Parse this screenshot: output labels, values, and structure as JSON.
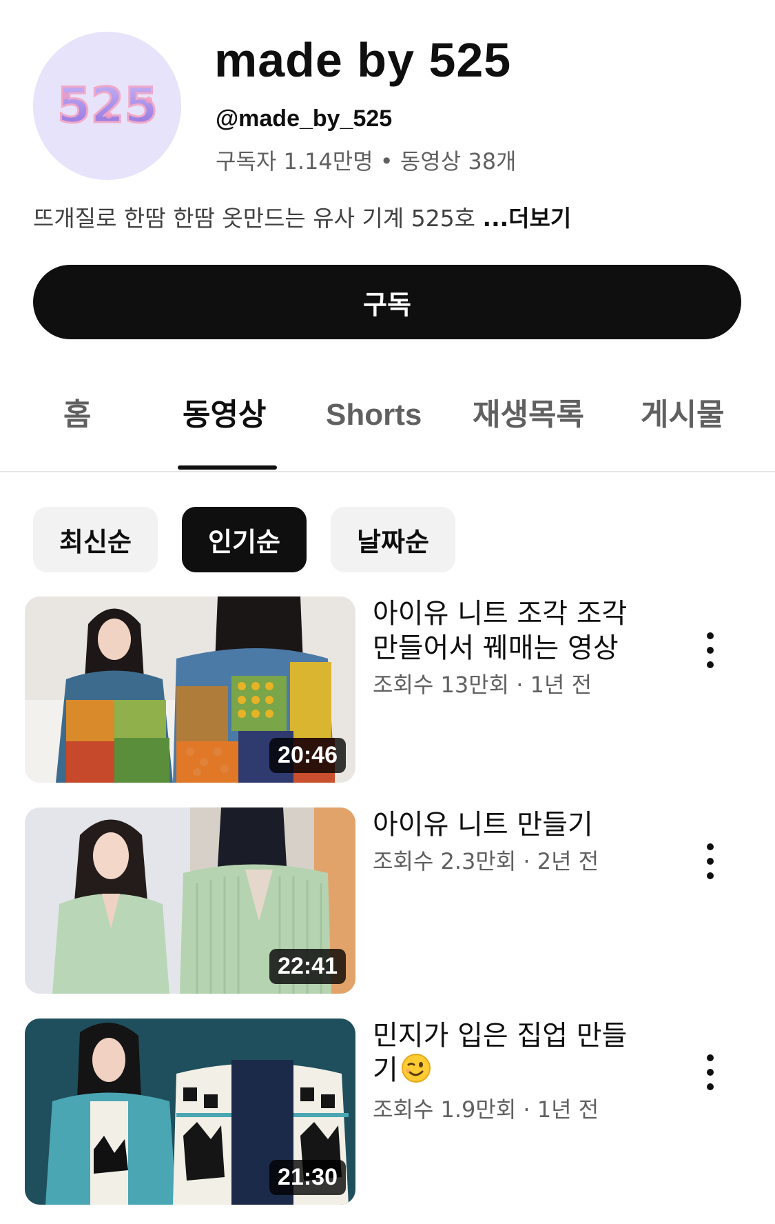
{
  "channel": {
    "avatar_text": "525",
    "name": "made by 525",
    "handle": "@made_by_525",
    "stats": "구독자 1.14만명 • 동영상 38개",
    "description": "뜨개질로 한땀 한땀 옷만드는 유사 기계 525호 ",
    "description_more": "...더보기",
    "subscribe_label": "구독"
  },
  "tabs": [
    {
      "label": "홈",
      "active": false
    },
    {
      "label": "동영상",
      "active": true
    },
    {
      "label": "Shorts",
      "active": false
    },
    {
      "label": "재생목록",
      "active": false
    },
    {
      "label": "게시물",
      "active": false
    }
  ],
  "chips": [
    {
      "label": "최신순",
      "active": false
    },
    {
      "label": "인기순",
      "active": true
    },
    {
      "label": "날짜순",
      "active": false
    }
  ],
  "videos": [
    {
      "title_line1": "아이유 니트 조각 조각",
      "title_line2": "만들어서 꿰매는 영상",
      "meta": "조회수 13만회 · 1년 전",
      "duration": "20:46"
    },
    {
      "title_line1": "아이유 니트 만들기",
      "title_line2": "",
      "meta": "조회수 2.3만회 · 2년 전",
      "duration": "22:41"
    },
    {
      "title_line1": "민지가 입은 집업 만들",
      "title_line2": "기",
      "meta": "조회수 1.9만회 · 1년 전",
      "duration": "21:30"
    }
  ],
  "colors": {
    "subscribe_bg": "#0f0f0f",
    "chip_active_bg": "#0f0f0f",
    "chip_bg": "#f2f2f2",
    "avatar_bg": "#e7e3fb",
    "avatar_text": "#9b7fe0"
  }
}
